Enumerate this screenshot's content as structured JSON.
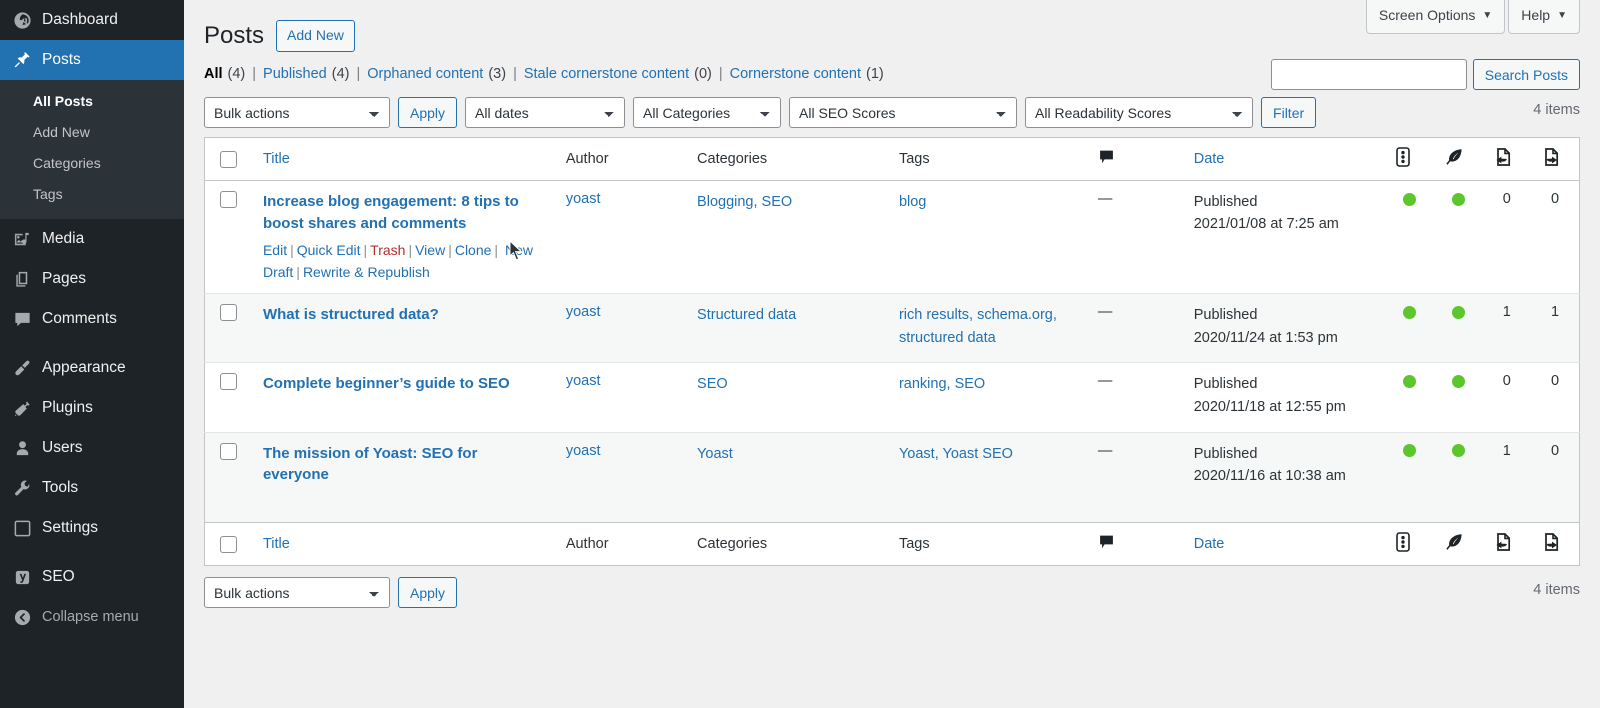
{
  "sidebar": {
    "items": [
      {
        "label": "Dashboard",
        "icon": "dashboard-icon",
        "current": false
      },
      {
        "label": "Posts",
        "icon": "pin-icon",
        "current": true
      },
      {
        "label": "Media",
        "icon": "media-icon",
        "current": false
      },
      {
        "label": "Pages",
        "icon": "pages-icon",
        "current": false
      },
      {
        "label": "Comments",
        "icon": "comments-icon",
        "current": false
      },
      {
        "label": "Appearance",
        "icon": "appearance-brush-icon",
        "current": false
      },
      {
        "label": "Plugins",
        "icon": "plugins-plug-icon",
        "current": false
      },
      {
        "label": "Users",
        "icon": "users-icon",
        "current": false
      },
      {
        "label": "Tools",
        "icon": "tools-wrench-icon",
        "current": false
      },
      {
        "label": "Settings",
        "icon": "settings-sliders-icon",
        "current": false
      },
      {
        "label": "SEO",
        "icon": "yoast-seo-icon",
        "current": false
      }
    ],
    "submenu": [
      {
        "label": "All Posts",
        "current": true
      },
      {
        "label": "Add New",
        "current": false
      },
      {
        "label": "Categories",
        "current": false
      },
      {
        "label": "Tags",
        "current": false
      }
    ],
    "collapse": {
      "label": "Collapse menu",
      "icon": "collapse-arrow-icon"
    }
  },
  "screen_meta": [
    {
      "label": "Screen Options",
      "caret": "▼"
    },
    {
      "label": "Help",
      "caret": "▼"
    }
  ],
  "header": {
    "title": "Posts",
    "add_new_label": "Add New"
  },
  "search": {
    "value": "",
    "placeholder": "",
    "button_label": "Search Posts"
  },
  "status_links": [
    {
      "label": "All",
      "count": "(4)",
      "current": true
    },
    {
      "label": "Published",
      "count": "(4)",
      "current": false
    },
    {
      "label": "Orphaned content",
      "count": "(3)",
      "current": false
    },
    {
      "label": "Stale cornerstone content",
      "count": "(0)",
      "current": false
    },
    {
      "label": "Cornerstone content",
      "count": "(1)",
      "current": false
    }
  ],
  "tablenav_top": {
    "bulk_actions": "Bulk actions",
    "apply_label": "Apply",
    "dates": "All dates",
    "categories": "All Categories",
    "seo_scores": "All SEO Scores",
    "readability_scores": "All Readability Scores",
    "filter_label": "Filter",
    "items_count": "4 items"
  },
  "tablenav_bottom": {
    "bulk_actions": "Bulk actions",
    "apply_label": "Apply",
    "items_count": "4 items"
  },
  "table": {
    "columns": {
      "title": "Title",
      "author": "Author",
      "categories": "Categories",
      "tags": "Tags",
      "comments_icon": "comment-bubble-icon",
      "date": "Date",
      "seo_icon": "seo-score-traffic-light-icon",
      "readability_icon": "readability-feather-icon",
      "incoming_links_icon": "incoming-links-document-icon",
      "outgoing_links_icon": "outgoing-links-document-icon"
    },
    "rows": [
      {
        "title": "Increase blog engagement: 8 tips to boost shares and comments",
        "author": "yoast",
        "categories": "Blogging, SEO",
        "tags": "blog",
        "comments": "—",
        "date_status": "Published",
        "date_value": "2021/01/08 at 7:25 am",
        "seo_score": "good",
        "readability_score": "good",
        "incoming_links": "0",
        "outgoing_links": "0",
        "actions": [
          {
            "label": "Edit",
            "kind": "edit"
          },
          {
            "label": "Quick Edit",
            "kind": "quick-edit"
          },
          {
            "label": "Trash",
            "kind": "trash"
          },
          {
            "label": "View",
            "kind": "view"
          },
          {
            "label": "Clone",
            "kind": "clone"
          },
          {
            "label": "New Draft",
            "kind": "new-draft"
          },
          {
            "label": "Rewrite & Republish",
            "kind": "rewrite-republish"
          }
        ]
      },
      {
        "title": "What is structured data?",
        "author": "yoast",
        "categories": "Structured data",
        "tags": "rich results, schema.org, structured data",
        "comments": "—",
        "date_status": "Published",
        "date_value": "2020/11/24 at 1:53 pm",
        "seo_score": "good",
        "readability_score": "good",
        "incoming_links": "1",
        "outgoing_links": "1",
        "actions": []
      },
      {
        "title": "Complete beginner’s guide to SEO",
        "author": "yoast",
        "categories": "SEO",
        "tags": "ranking, SEO",
        "comments": "—",
        "date_status": "Published",
        "date_value": "2020/11/18 at 12:55 pm",
        "seo_score": "good",
        "readability_score": "good",
        "incoming_links": "0",
        "outgoing_links": "0",
        "actions": []
      },
      {
        "title": "The mission of Yoast: SEO for everyone",
        "author": "yoast",
        "categories": "Yoast",
        "tags": "Yoast, Yoast SEO",
        "comments": "—",
        "date_status": "Published",
        "date_value": "2020/11/16 at 10:38 am",
        "seo_score": "good",
        "readability_score": "good",
        "incoming_links": "1",
        "outgoing_links": "0",
        "actions": []
      }
    ]
  },
  "colors": {
    "admin_bg": "#1d2327",
    "submenu_bg": "#2c3338",
    "current_menu": "#2271b1",
    "link": "#2271b1",
    "trash": "#b32d2e",
    "score_good": "#5cc62d",
    "page_bg": "#f0f0f1"
  }
}
